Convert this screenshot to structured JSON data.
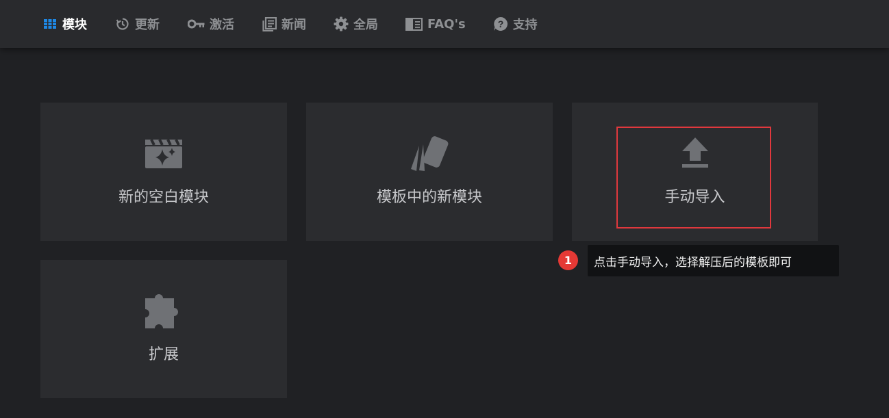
{
  "nav": {
    "items": [
      {
        "label": "模块",
        "icon": "grid-icon",
        "active": true
      },
      {
        "label": "更新",
        "icon": "history-icon",
        "active": false
      },
      {
        "label": "激活",
        "icon": "key-icon",
        "active": false
      },
      {
        "label": "新闻",
        "icon": "news-icon",
        "active": false
      },
      {
        "label": "全局",
        "icon": "gear-icon",
        "active": false
      },
      {
        "label": "FAQ's",
        "icon": "book-icon",
        "active": false
      },
      {
        "label": "支持",
        "icon": "help-icon",
        "active": false
      }
    ]
  },
  "cards": {
    "blank": {
      "label": "新的空白模块",
      "icon": "clapperboard-sparkle-icon"
    },
    "template": {
      "label": "模板中的新模块",
      "icon": "template-cards-icon"
    },
    "import": {
      "label": "手动导入",
      "icon": "upload-icon"
    },
    "extensions": {
      "label": "扩展",
      "icon": "puzzle-icon"
    }
  },
  "annotation": {
    "badge": "1",
    "tooltip": "点击手动导入，选择解压后的模板即可"
  },
  "colors": {
    "background": "#202124",
    "topbar": "#292a2d",
    "card": "#2b2c2f",
    "active_icon": "#1e88e5",
    "highlight_border": "#e0383d",
    "badge": "#e53935"
  }
}
